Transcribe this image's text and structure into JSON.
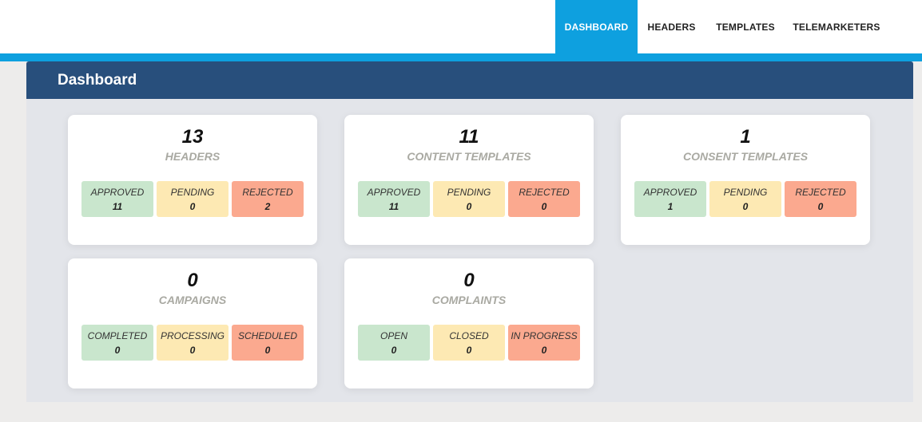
{
  "nav": {
    "items": [
      {
        "label": "DASHBOARD",
        "active": true
      },
      {
        "label": "HEADERS",
        "active": false
      },
      {
        "label": "TEMPLATES",
        "active": false
      },
      {
        "label": "TELEMARKETERS",
        "active": false
      }
    ]
  },
  "panel": {
    "title": "Dashboard"
  },
  "cards": [
    {
      "count": "13",
      "label": "HEADERS",
      "stats": [
        {
          "name": "APPROVED",
          "value": "11"
        },
        {
          "name": "PENDING",
          "value": "0"
        },
        {
          "name": "REJECTED",
          "value": "2"
        }
      ]
    },
    {
      "count": "11",
      "label": "CONTENT TEMPLATES",
      "stats": [
        {
          "name": "APPROVED",
          "value": "11"
        },
        {
          "name": "PENDING",
          "value": "0"
        },
        {
          "name": "REJECTED",
          "value": "0"
        }
      ]
    },
    {
      "count": "1",
      "label": "CONSENT TEMPLATES",
      "stats": [
        {
          "name": "APPROVED",
          "value": "1"
        },
        {
          "name": "PENDING",
          "value": "0"
        },
        {
          "name": "REJECTED",
          "value": "0"
        }
      ]
    },
    {
      "count": "0",
      "label": "CAMPAIGNS",
      "stats": [
        {
          "name": "COMPLETED",
          "value": "0"
        },
        {
          "name": "PROCESSING",
          "value": "0"
        },
        {
          "name": "SCHEDULED",
          "value": "0"
        }
      ]
    },
    {
      "count": "0",
      "label": "COMPLAINTS",
      "stats": [
        {
          "name": "OPEN",
          "value": "0"
        },
        {
          "name": "CLOSED",
          "value": "0"
        },
        {
          "name": "IN PROGRESS",
          "value": "0"
        }
      ]
    }
  ],
  "colors": {
    "accent": "#0ea0df",
    "header": "#284f7c",
    "green": "#c9e6cd",
    "yellow": "#fde9b3",
    "red": "#fba98f"
  }
}
